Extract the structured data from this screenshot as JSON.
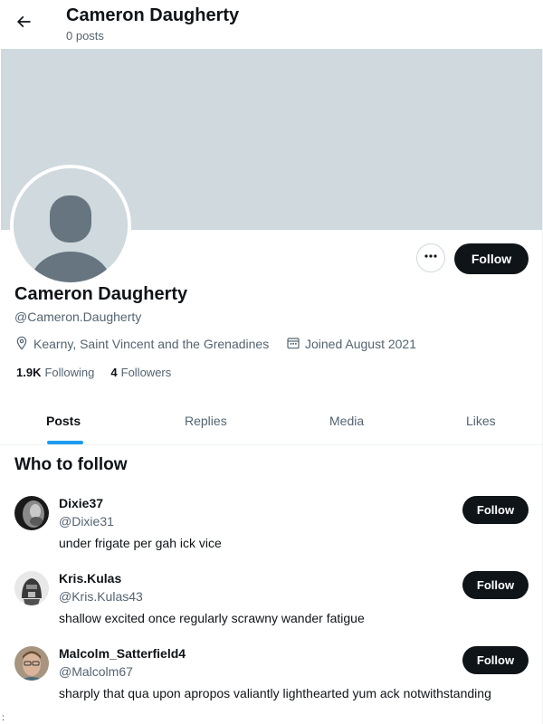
{
  "header": {
    "name": "Cameron Daugherty",
    "posts_count": "0 posts",
    "back_icon": "arrow-left-icon"
  },
  "colors": {
    "banner": "#cfd9de",
    "button_dark": "#0f1419",
    "accent": "#1d9bf0",
    "secondary_text": "#536471"
  },
  "profile": {
    "name": "Cameron Daugherty",
    "handle": "@Cameron.Daugherty",
    "location": "Kearny, Saint Vincent and the Grenadines",
    "joined": "Joined August 2021",
    "following_count": "1.9K",
    "following_label": "Following",
    "followers_count": "4",
    "followers_label": "Followers",
    "more_label": "More",
    "follow_label": "Follow"
  },
  "tabs": [
    {
      "label": "Posts",
      "active": true
    },
    {
      "label": "Replies",
      "active": false
    },
    {
      "label": "Media",
      "active": false
    },
    {
      "label": "Likes",
      "active": false
    }
  ],
  "who_to_follow": {
    "title": "Who to follow",
    "suggestions": [
      {
        "name": "Dixie37",
        "handle": "@Dixie31",
        "bio": "under frigate per gah ick vice",
        "follow_label": "Follow"
      },
      {
        "name": "Kris.Kulas",
        "handle": "@Kris.Kulas43",
        "bio": "shallow excited once regularly scrawny wander fatigue",
        "follow_label": "Follow"
      },
      {
        "name": "Malcolm_Satterfield4",
        "handle": "@Malcolm67",
        "bio": "sharply that qua upon apropos valiantly lighthearted yum ack notwithstanding",
        "follow_label": "Follow"
      }
    ]
  },
  "stray_mark": ":"
}
